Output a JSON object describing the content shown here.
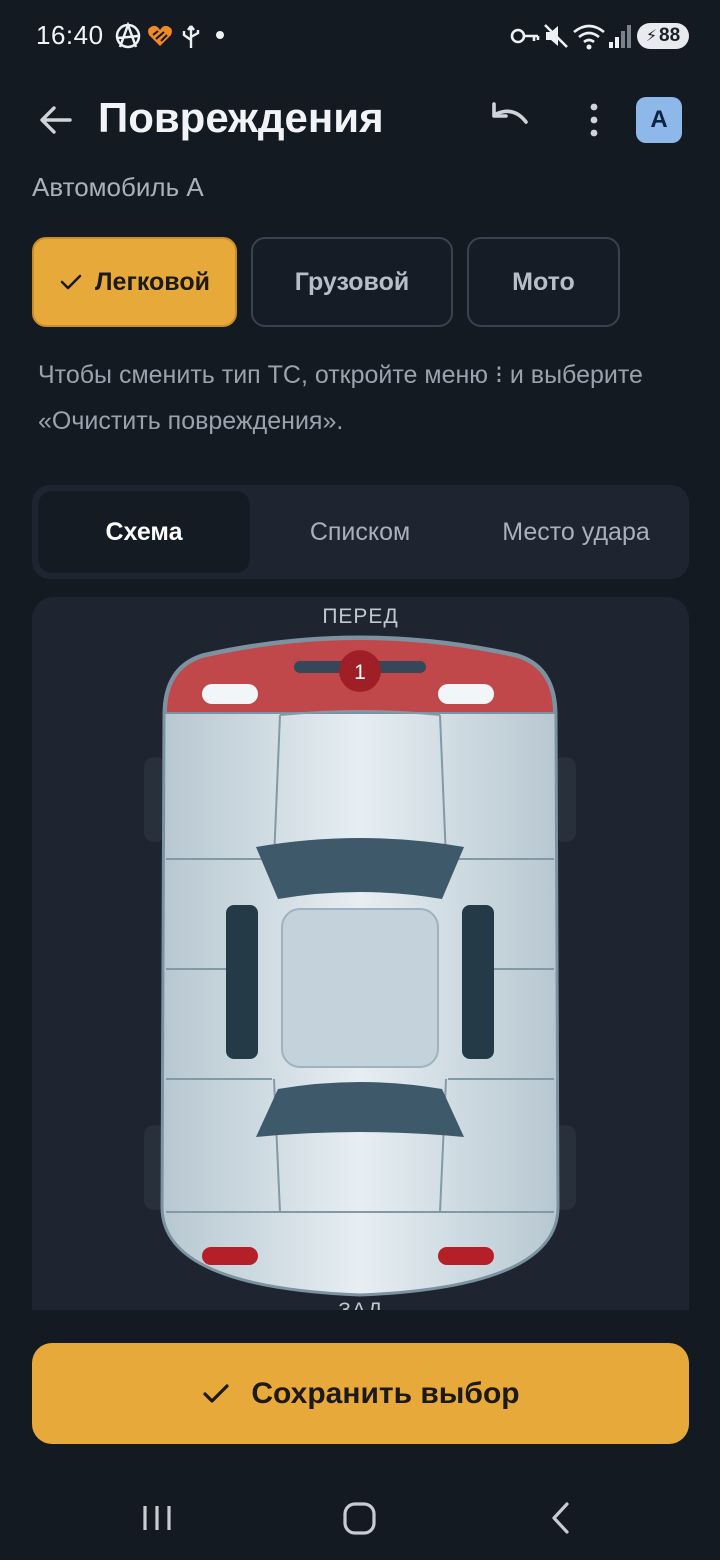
{
  "status_bar": {
    "time": "16:40",
    "battery": "88",
    "left_icons": [
      "anarchy-icon",
      "app-heart-icon",
      "usb-icon",
      "dot-icon"
    ],
    "right_icons": [
      "vpn-key-icon",
      "mute-icon",
      "wifi-icon",
      "signal-icon",
      "battery-icon"
    ]
  },
  "app_bar": {
    "title": "Повреждения",
    "avatar_letter": "A"
  },
  "vehicle_name": "Автомобиль А",
  "vehicle_types": [
    {
      "label": "Легковой",
      "selected": true
    },
    {
      "label": "Грузовой",
      "selected": false
    },
    {
      "label": "Мото",
      "selected": false
    }
  ],
  "hint": "Чтобы сменить тип ТС, откройте меню ⁝ и выберите «Очистить повреждения».",
  "view_tabs": [
    {
      "label": "Схема",
      "active": true
    },
    {
      "label": "Списком",
      "active": false
    },
    {
      "label": "Место удара",
      "active": false
    }
  ],
  "diagram": {
    "front_label": "ПЕРЕД",
    "rear_label": "ЗАД",
    "damage_markers": [
      {
        "number": "1",
        "zone": "front-bumper"
      }
    ],
    "colors": {
      "damage": "#c0484a",
      "body": "#cfdbe3",
      "glass": "#3e5a6a",
      "marker": "#9e1f25"
    }
  },
  "save_button": {
    "label": "Сохранить выбор"
  },
  "colors": {
    "accent": "#e8a93b",
    "background": "#141a22",
    "card": "#1e2530"
  }
}
